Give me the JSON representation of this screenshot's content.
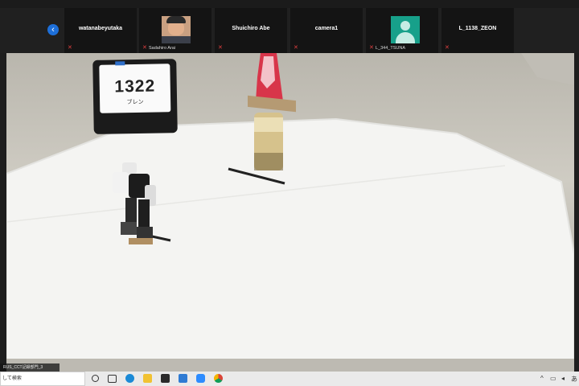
{
  "meeting": {
    "participants": [
      {
        "name": "watanabeyutaka",
        "caption": "",
        "type": "name"
      },
      {
        "name": "",
        "caption": "Sadahiro Arai",
        "type": "photo"
      },
      {
        "name": "Shuichiro Abe",
        "caption": "",
        "type": "name"
      },
      {
        "name": "camera1",
        "caption": "",
        "type": "name"
      },
      {
        "name": "",
        "caption": "L_344_TSUNA",
        "type": "avatar"
      },
      {
        "name": "L_1138_ZEON",
        "caption": "",
        "type": "name"
      }
    ],
    "nav_icon": "chevron-left-icon"
  },
  "video": {
    "card_number": "1322",
    "card_name": "ブレン",
    "overlay_label": "RUS_CCT記録部門_3"
  },
  "taskbar": {
    "search_placeholder": "して検索",
    "icons": [
      "cortana-icon",
      "task-view-icon",
      "edge-icon",
      "explorer-icon",
      "store-icon",
      "mail-icon",
      "zoom-icon",
      "chrome-icon"
    ]
  },
  "colors": {
    "accent": "#1d6fd9",
    "mic_muted": "#e04040"
  }
}
